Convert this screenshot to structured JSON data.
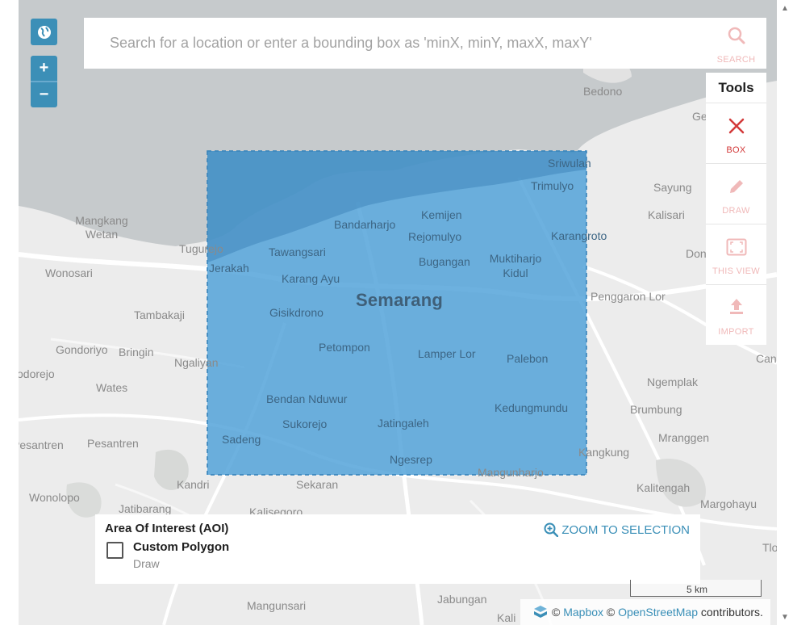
{
  "search": {
    "placeholder": "Search for a location or enter a bounding box as 'minX, minY, maxX, maxY'",
    "button_label": "SEARCH"
  },
  "controls": {
    "globe_icon": "globe-icon",
    "zoom_in_label": "+",
    "zoom_out_label": "−"
  },
  "tools": {
    "heading": "Tools",
    "items": [
      {
        "label": "BOX",
        "icon": "close-x-icon",
        "state": "active"
      },
      {
        "label": "DRAW",
        "icon": "pencil-icon",
        "state": "faded"
      },
      {
        "label": "THIS VIEW",
        "icon": "viewport-icon",
        "state": "faded"
      },
      {
        "label": "IMPORT",
        "icon": "upload-icon",
        "state": "faded"
      }
    ]
  },
  "map": {
    "city_label": "Semarang",
    "places": [
      "Bedono",
      "Ge",
      "Sriwulan",
      "Trimulyo",
      "Sayung",
      "Kalisari",
      "Mangkang Wetan",
      "Tugurejo",
      "Jerakah",
      "Tawangsari",
      "Bandarharjo",
      "Kemijen",
      "Rejomulyo",
      "Karangroto",
      "Bugangan",
      "Muktiharjo Kidul",
      "Don",
      "Wonosari",
      "Karang Ayu",
      "Penggaron Lor",
      "Tambakaji",
      "Gisikdrono",
      "Gondoriyo",
      "Bringin",
      "Ngaliyan",
      "Petompon",
      "Lamper Lor",
      "Palebon",
      "Can",
      "odorejo",
      "Wates",
      "Ngemplak",
      "Bendan Nduwur",
      "Brumbung",
      "Kedungmundu",
      "Sukorejo",
      "Jatingaleh",
      "Mranggen",
      "Sadeng",
      "Kangkung",
      "Pesantren",
      "Ngesrep",
      "Mangunharjo",
      "Kandri",
      "Sekaran",
      "Kalitengah",
      "Wonolopo",
      "Jatibarang",
      "Kalisegoro",
      "Margohayu",
      "Tlo",
      "Mangunsari",
      "Jabungan",
      "Kali"
    ]
  },
  "aoi": {
    "title": "Area Of Interest (AOI)",
    "zoom_label": "ZOOM TO SELECTION",
    "polygon_name": "Custom Polygon",
    "polygon_sub": "Draw"
  },
  "scale": {
    "label": "5 km"
  },
  "attribution": {
    "mapbox": "Mapbox",
    "osm": "OpenStreetMap",
    "suffix": "contributors.",
    "copyright": "©"
  },
  "colors": {
    "accent": "#3c8fb7",
    "selection": "#4da0d8",
    "tool_active": "#d33a3a",
    "tool_faded": "#f0b9b9"
  }
}
